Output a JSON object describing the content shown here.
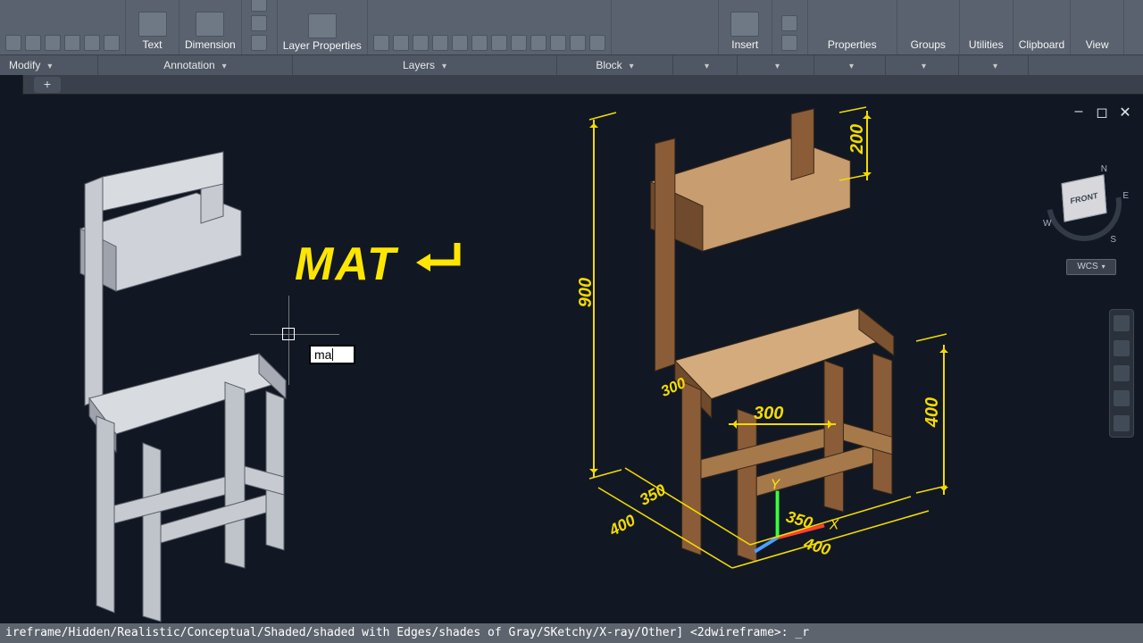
{
  "ribbon": {
    "modify_label": "Modify",
    "text_label": "Text",
    "dimension_label": "Dimension",
    "annotation_label": "Annotation",
    "layerprops_label": "Layer\nProperties",
    "layers_label": "Layers",
    "insert_label": "Insert",
    "block_label": "Block",
    "groups_label": "Groups",
    "properties_label": "Properties",
    "utilities_label": "Utilities",
    "clipboard_label": "Clipboard",
    "view_label": "View"
  },
  "canvas": {
    "annotation": "MAT",
    "command_input": "ma",
    "navcube_face": "FRONT",
    "wcs_label": "WCS",
    "nav_N": "N",
    "nav_S": "S",
    "nav_E": "E",
    "nav_W": "W",
    "ucs_x": "X",
    "ucs_y": "Y"
  },
  "dimensions": {
    "h900": "900",
    "h200": "200",
    "h400": "400",
    "w300top": "300",
    "w300mid": "300",
    "d350a": "350",
    "d350b": "350",
    "d400a": "400",
    "d400b": "400"
  },
  "cmdline": "ireframe/Hidden/Realistic/Conceptual/Shaded/shaded with Edges/shades of Gray/SKetchy/X-ray/Other] <2dwireframe>: _r"
}
